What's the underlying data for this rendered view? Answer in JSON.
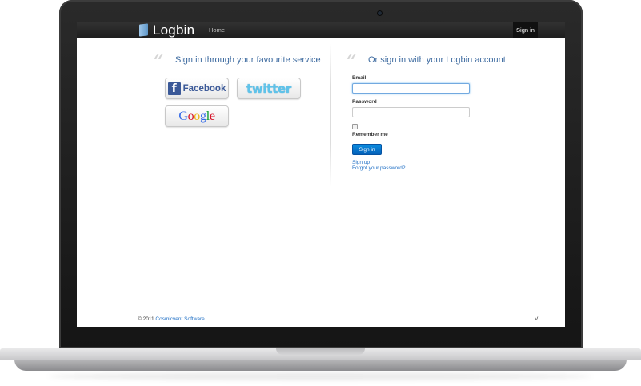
{
  "app": {
    "brand": "Logbin",
    "nav": {
      "home": "Home",
      "sign_in": "Sign in"
    }
  },
  "services": {
    "title": "Sign in through your favourite service",
    "facebook": {
      "icon": "f",
      "label": "Facebook"
    },
    "twitter": {
      "label": "twitter"
    },
    "google": {
      "letters": [
        "G",
        "o",
        "o",
        "g",
        "l",
        "e"
      ],
      "colors": [
        "#3369e8",
        "#d50f25",
        "#eeb211",
        "#3369e8",
        "#009925",
        "#d50f25"
      ]
    }
  },
  "login": {
    "title": "Or sign in with your Logbin account",
    "email_label": "Email",
    "email_value": "",
    "password_label": "Password",
    "password_value": "",
    "remember_label": "Remember me",
    "submit": "Sign in",
    "signup_link": "Sign up",
    "forgot_link": "Forgot your password?"
  },
  "footer": {
    "copyright": "© 2011",
    "company": "Cosmicvent Software",
    "version": "V"
  },
  "colors": {
    "accent": "#3e6ba0",
    "link": "#1f6fc5",
    "button": "#0b8de0",
    "navbar": "#222222"
  }
}
